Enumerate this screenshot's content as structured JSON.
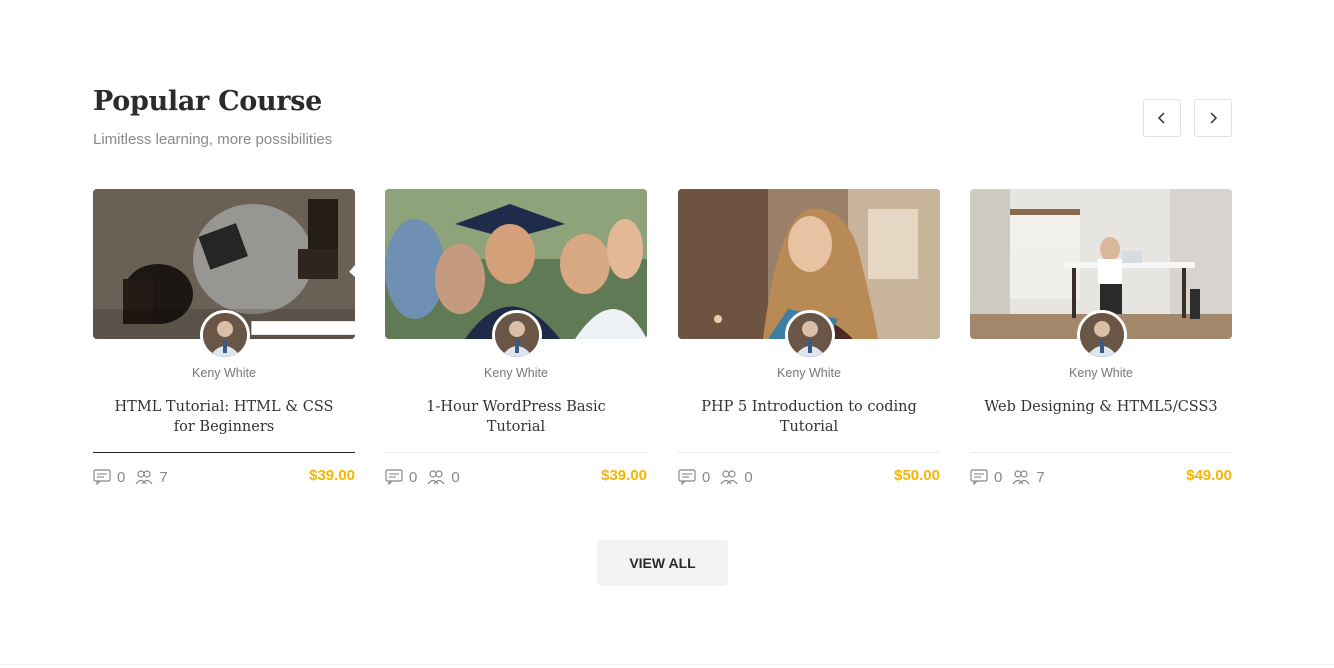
{
  "section": {
    "title": "Popular Course",
    "subtitle": "Limitless learning, more possibilities"
  },
  "icons": {
    "prev": "chevron-left-icon",
    "next": "chevron-right-icon",
    "comments": "comment-icon",
    "students": "users-icon",
    "hover": "arrow-right-icon"
  },
  "colors": {
    "price": "#f6b500",
    "title": "#2b2b2b",
    "muted": "#8a8a8a"
  },
  "courses": [
    {
      "author": "Keny White",
      "title": "HTML Tutorial: HTML & CSS for Beginners",
      "comments": "0",
      "students": "7",
      "price": "$39.00"
    },
    {
      "author": "Keny White",
      "title": "1-Hour WordPress Basic Tutorial",
      "comments": "0",
      "students": "0",
      "price": "$39.00"
    },
    {
      "author": "Keny White",
      "title": "PHP 5 Introduction to coding Tutorial",
      "comments": "0",
      "students": "0",
      "price": "$50.00"
    },
    {
      "author": "Keny White",
      "title": "Web Designing & HTML5/CSS3",
      "comments": "0",
      "students": "7",
      "price": "$49.00"
    }
  ],
  "view_all_label": "VIEW ALL"
}
